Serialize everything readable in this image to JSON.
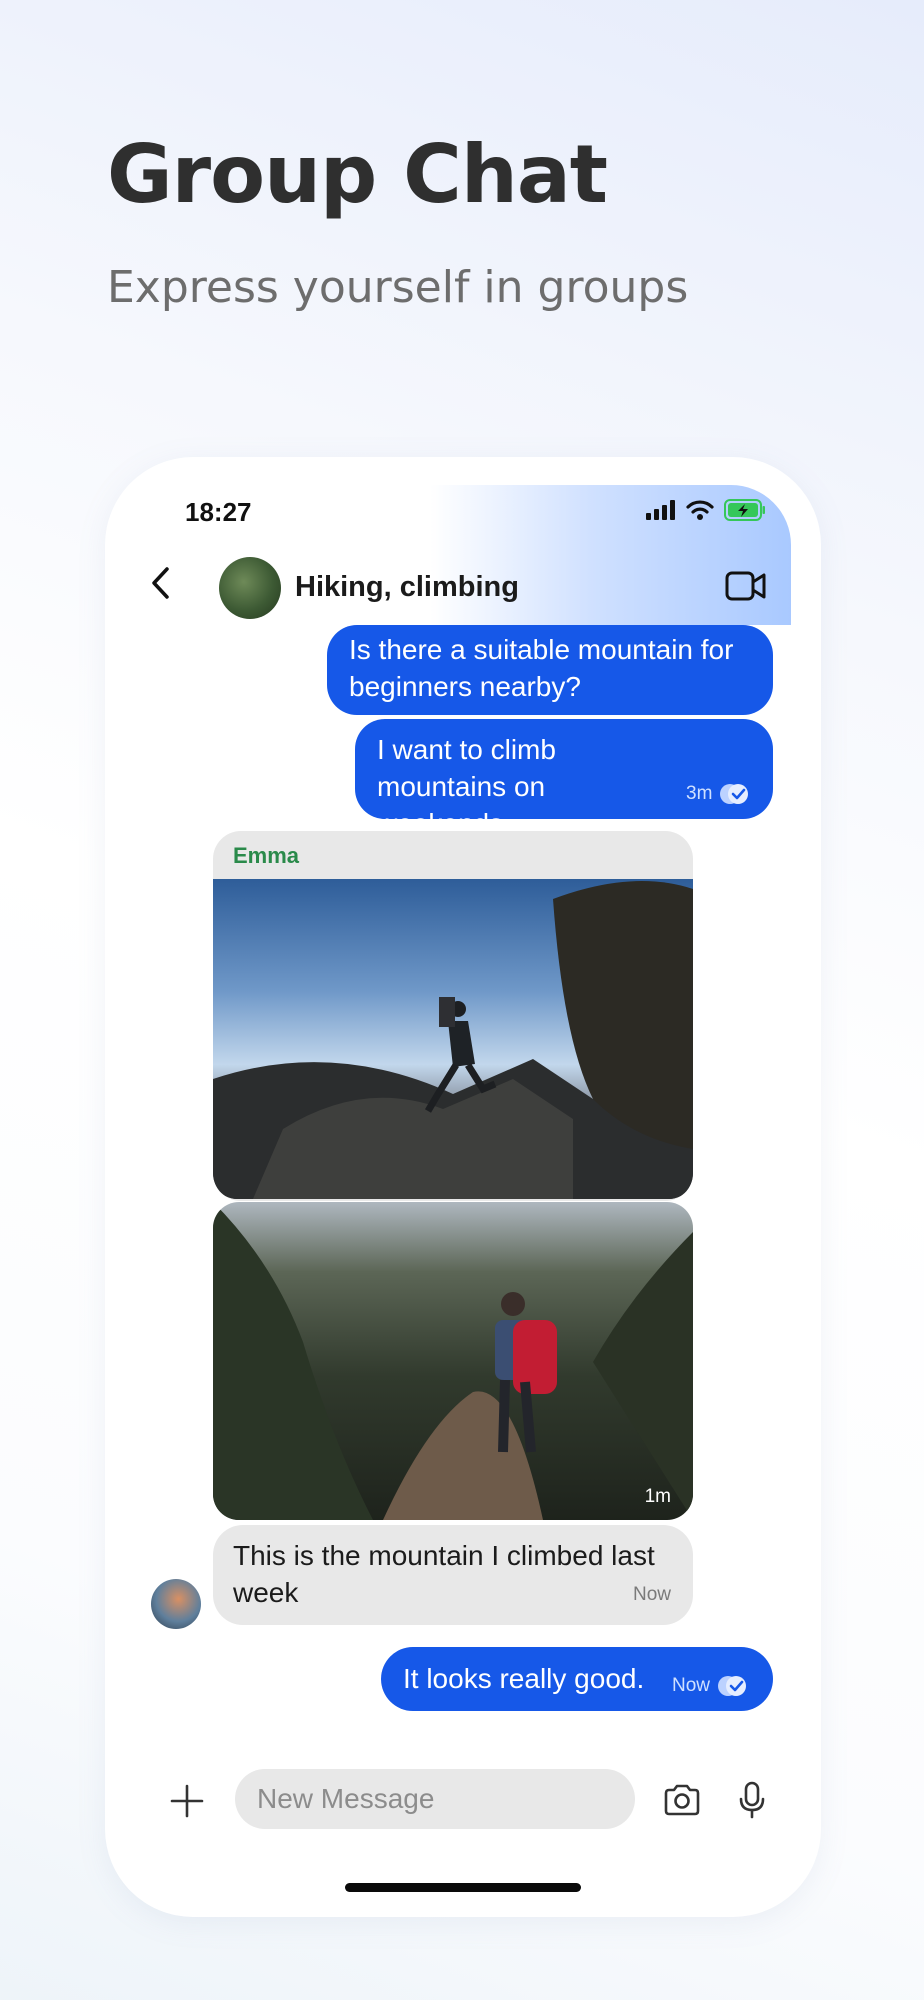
{
  "promo": {
    "title": "Group Chat",
    "subtitle": "Express yourself in groups"
  },
  "status_bar": {
    "time": "18:27"
  },
  "chat_header": {
    "group_name": "Hiking, climbing",
    "icons": [
      "chevron-left-icon",
      "video-camera-icon"
    ]
  },
  "messages": [
    {
      "direction": "out",
      "text": "Is there a suitable mountain for beginners nearby?"
    },
    {
      "direction": "out",
      "text": "I want to climb mountains on weekends.",
      "time": "3m",
      "status": "read"
    },
    {
      "direction": "in",
      "sender": "Emma",
      "type": "photo",
      "description": "hiker on rocky summit"
    },
    {
      "direction": "in",
      "sender": "Emma",
      "type": "photo",
      "description": "hiker with red backpack on trail",
      "time": "1m"
    },
    {
      "direction": "in",
      "sender": "Emma",
      "text": "This is the mountain I climbed last week",
      "time": "Now"
    },
    {
      "direction": "out",
      "text": "It looks really good.",
      "time": "Now",
      "status": "read"
    }
  ],
  "composer": {
    "placeholder": "New Message",
    "icons": [
      "plus-icon",
      "camera-icon",
      "microphone-icon"
    ]
  },
  "colors": {
    "accent": "#1658e8",
    "incoming_bubble": "#e8e8e8",
    "sender_name": "#2a8a4a",
    "battery": "#35c759"
  }
}
